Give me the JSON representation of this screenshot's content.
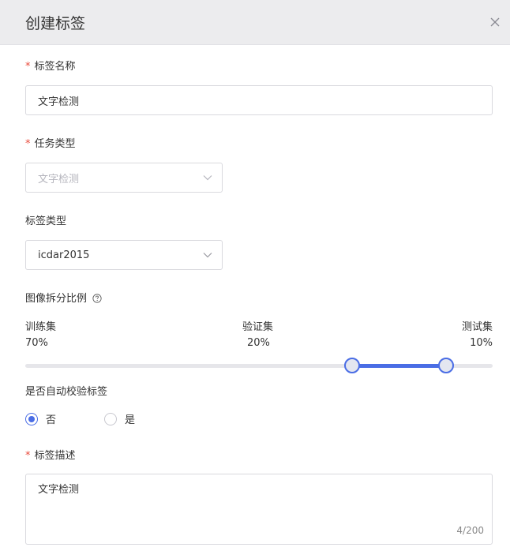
{
  "dialog": {
    "title": "创建标签",
    "close_icon": "close-icon"
  },
  "form": {
    "required_mark": "*",
    "tag_name": {
      "label": "标签名称",
      "value": "文字检测"
    },
    "task_type": {
      "label": "任务类型",
      "value": "文字检测",
      "disabled": true
    },
    "tag_type": {
      "label": "标签类型",
      "value": "icdar2015"
    },
    "split": {
      "label": "图像拆分比例",
      "help_icon": "help-circle-icon",
      "train": {
        "label": "训练集",
        "value": "70%",
        "fraction": 0.7
      },
      "val": {
        "label": "验证集",
        "value": "20%",
        "fraction": 0.2
      },
      "test": {
        "label": "测试集",
        "value": "10%",
        "fraction": 0.1
      }
    },
    "auto_check": {
      "label": "是否自动校验标签",
      "options": [
        {
          "label": "否",
          "checked": true
        },
        {
          "label": "是",
          "checked": false
        }
      ]
    },
    "description": {
      "label": "标签描述",
      "value": "文字检测",
      "counter": "4/200"
    }
  },
  "colors": {
    "accent": "#4a6de5",
    "required": "#e94b3c",
    "header_bg": "#ececee"
  }
}
